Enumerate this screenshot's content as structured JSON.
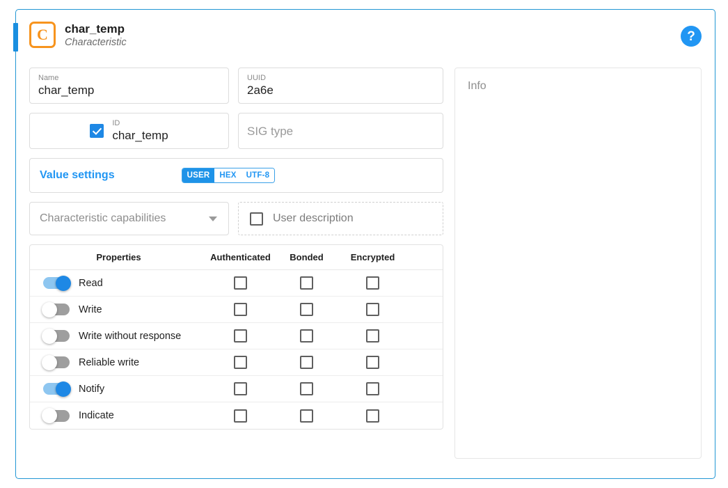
{
  "header": {
    "icon": "characteristic-c-icon",
    "icon_letter": "C",
    "title": "char_temp",
    "subtitle": "Characteristic",
    "help_label": "?"
  },
  "fields": {
    "name": {
      "label": "Name",
      "value": "char_temp"
    },
    "uuid": {
      "label": "UUID",
      "value": "2a6e"
    },
    "id": {
      "label": "ID",
      "value": "char_temp",
      "checked": true
    },
    "sig_type": {
      "placeholder": "SIG type"
    }
  },
  "value_settings": {
    "label": "Value settings",
    "segments": [
      {
        "label": "USER",
        "active": true
      },
      {
        "label": "HEX",
        "active": false
      },
      {
        "label": "UTF-8",
        "active": false
      }
    ]
  },
  "capabilities": {
    "placeholder": "Characteristic capabilities"
  },
  "user_description": {
    "label": "User description",
    "checked": false
  },
  "properties_table": {
    "headers": [
      "Properties",
      "Authenticated",
      "Bonded",
      "Encrypted"
    ],
    "rows": [
      {
        "name": "Read",
        "enabled": true,
        "authenticated": false,
        "bonded": false,
        "encrypted": false
      },
      {
        "name": "Write",
        "enabled": false,
        "authenticated": false,
        "bonded": false,
        "encrypted": false
      },
      {
        "name": "Write without response",
        "enabled": false,
        "authenticated": false,
        "bonded": false,
        "encrypted": false
      },
      {
        "name": "Reliable write",
        "enabled": false,
        "authenticated": false,
        "bonded": false,
        "encrypted": false
      },
      {
        "name": "Notify",
        "enabled": true,
        "authenticated": false,
        "bonded": false,
        "encrypted": false
      },
      {
        "name": "Indicate",
        "enabled": false,
        "authenticated": false,
        "bonded": false,
        "encrypted": false
      }
    ]
  },
  "info_panel": {
    "label": "Info",
    "content": ""
  },
  "colors": {
    "accent_blue": "#2196f3",
    "card_border": "#2196d4",
    "icon_orange": "#f7941e",
    "toggle_on": "#1e88e5",
    "toggle_off": "#9e9e9e"
  }
}
